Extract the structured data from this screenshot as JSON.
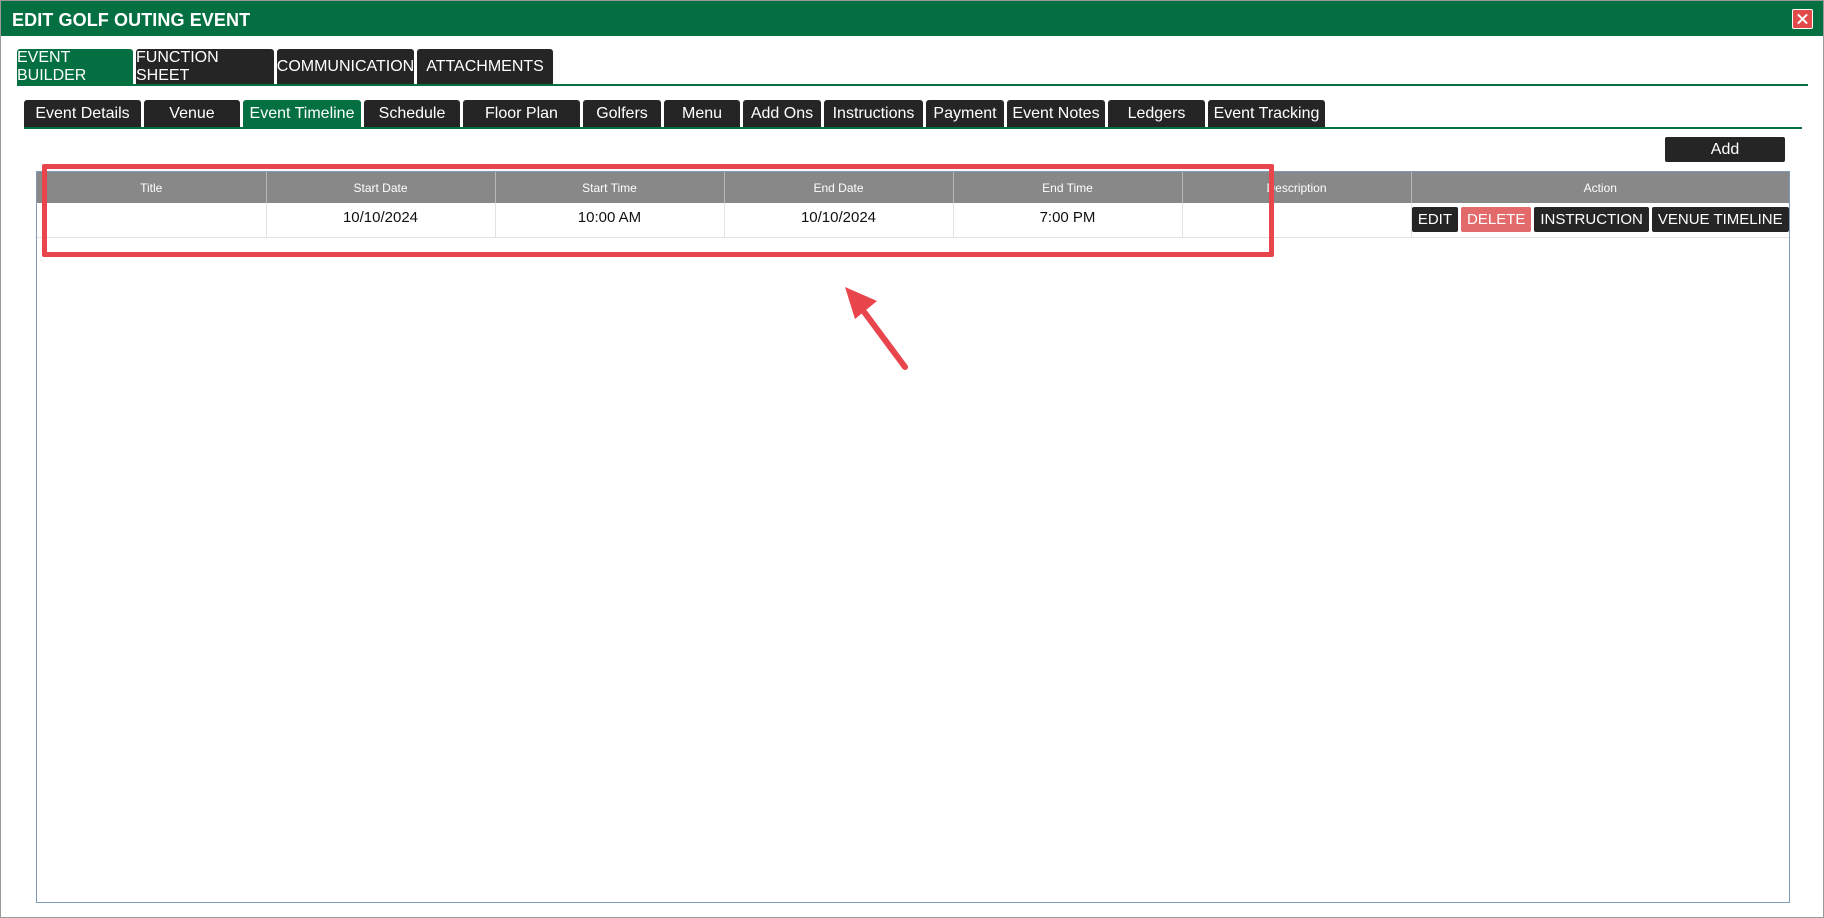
{
  "window": {
    "title": "EDIT GOLF OUTING EVENT"
  },
  "main_tabs": [
    {
      "label": "EVENT BUILDER",
      "active": true
    },
    {
      "label": "FUNCTION SHEET",
      "active": false
    },
    {
      "label": "COMMUNICATION",
      "active": false
    },
    {
      "label": "ATTACHMENTS",
      "active": false
    }
  ],
  "sub_tabs": [
    {
      "label": "Event Details",
      "active": false
    },
    {
      "label": "Venue",
      "active": false
    },
    {
      "label": "Event Timeline",
      "active": true
    },
    {
      "label": "Schedule",
      "active": false
    },
    {
      "label": "Floor Plan",
      "active": false
    },
    {
      "label": "Golfers",
      "active": false
    },
    {
      "label": "Menu",
      "active": false
    },
    {
      "label": "Add Ons",
      "active": false
    },
    {
      "label": "Instructions",
      "active": false
    },
    {
      "label": "Payment",
      "active": false
    },
    {
      "label": "Event Notes",
      "active": false
    },
    {
      "label": "Ledgers",
      "active": false
    },
    {
      "label": "Event Tracking",
      "active": false
    }
  ],
  "toolbar": {
    "add_label": "Add"
  },
  "grid": {
    "columns": [
      "Title",
      "Start Date",
      "Start Time",
      "End Date",
      "End Time",
      "Description",
      "Action"
    ],
    "rows": [
      {
        "title": "",
        "start_date": "10/10/2024",
        "start_time": "10:00 AM",
        "end_date": "10/10/2024",
        "end_time": "7:00 PM",
        "description": "",
        "actions": {
          "edit": "EDIT",
          "delete": "DELETE",
          "instruction": "INSTRUCTION",
          "venue_timeline": "VENUE TIMELINE"
        }
      }
    ]
  },
  "colors": {
    "brand_green": "#047041",
    "dark_tab": "#252525",
    "header_gray": "#888888",
    "delete_red": "#e36a6a",
    "annotation_red": "#e8454c"
  },
  "icons": {
    "close": "close-icon"
  }
}
